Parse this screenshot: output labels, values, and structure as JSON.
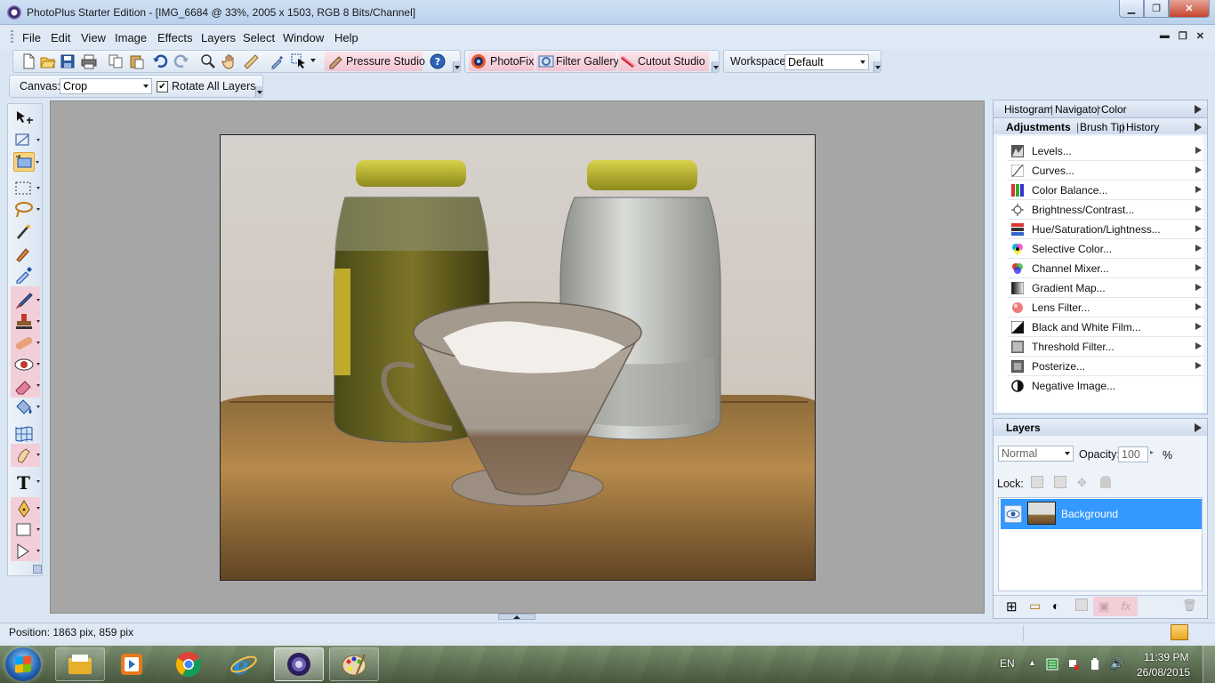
{
  "window": {
    "title": "PhotoPlus Starter Edition - [IMG_6684 @ 33%, 2005 x 1503, RGB 8 Bits/Channel]"
  },
  "menu": [
    "File",
    "Edit",
    "View",
    "Image",
    "Effects",
    "Layers",
    "Select",
    "Window",
    "Help"
  ],
  "toolbar": {
    "pressure_studio": "Pressure Studio",
    "photofix": "PhotoFix",
    "filter_gallery": "Filter Gallery",
    "cutout_studio": "Cutout Studio",
    "workspace_label": "Workspace",
    "workspace_value": "Default"
  },
  "context": {
    "canvas_label": "Canvas:",
    "canvas_value": "Crop",
    "rotate_label": "Rotate All Layers",
    "rotate_checked": true
  },
  "panels": {
    "top_tabs": [
      "Histogram",
      "Navigator",
      "Color"
    ],
    "adj_tabs": [
      "Adjustments",
      "Brush Tip",
      "History"
    ],
    "adjustments": [
      {
        "label": "Levels...",
        "icon": "levels-icon"
      },
      {
        "label": "Curves...",
        "icon": "curves-icon"
      },
      {
        "label": "Color Balance...",
        "icon": "color-balance-icon"
      },
      {
        "label": "Brightness/Contrast...",
        "icon": "brightness-icon"
      },
      {
        "label": "Hue/Saturation/Lightness...",
        "icon": "hue-saturation-icon"
      },
      {
        "label": "Selective Color...",
        "icon": "selective-color-icon"
      },
      {
        "label": "Channel Mixer...",
        "icon": "channel-mixer-icon"
      },
      {
        "label": "Gradient Map...",
        "icon": "gradient-map-icon"
      },
      {
        "label": "Lens Filter...",
        "icon": "lens-filter-icon"
      },
      {
        "label": "Black and White Film...",
        "icon": "black-white-icon"
      },
      {
        "label": "Threshold Filter...",
        "icon": "threshold-icon"
      },
      {
        "label": "Posterize...",
        "icon": "posterize-icon"
      },
      {
        "label": "Negative Image...",
        "icon": "negative-icon"
      }
    ],
    "layers": {
      "title": "Layers",
      "blend_mode": "Normal",
      "opacity_label": "Opacity:",
      "opacity_value": "100",
      "opacity_unit": "%",
      "lock_label": "Lock:",
      "layer_name": "Background"
    }
  },
  "status": {
    "position": "Position: 1863 pix, 859 pix"
  },
  "taskbar": {
    "lang": "EN",
    "time": "11:39 PM",
    "date": "26/08/2015"
  },
  "colors": {
    "accent": "#3399ff",
    "toolbar_pink": "#f1c4d1",
    "tool_selected": "#f7d47f"
  }
}
